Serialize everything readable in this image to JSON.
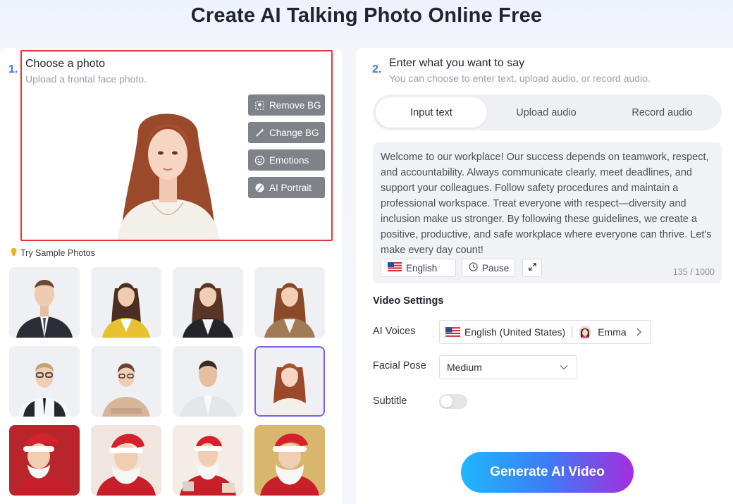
{
  "page": {
    "title": "Create AI Talking Photo Online Free"
  },
  "left": {
    "step_number": "1.",
    "title": "Choose a photo",
    "subtitle": "Upload a frontal face photo.",
    "tools": [
      {
        "label": "Remove BG",
        "icon": "remove-bg-icon"
      },
      {
        "label": "Change BG",
        "icon": "magic-wand-icon"
      },
      {
        "label": "Emotions",
        "icon": "smiley-icon"
      },
      {
        "label": "AI Portrait",
        "icon": "portrait-icon"
      }
    ],
    "samples_label": "Try Sample Photos",
    "samples_icon": "lightbulb-icon"
  },
  "right": {
    "step_number": "2.",
    "title": "Enter what you want to say",
    "subtitle": "You can choose to enter text, upload audio, or record audio.",
    "tabs": [
      "Input text",
      "Upload audio",
      "Record audio"
    ],
    "active_tab": "Input text",
    "text": "Welcome to our workplace! Our success depends on teamwork, respect, and accountability. Always communicate clearly, meet deadlines, and support your colleagues. Follow safety procedures and maintain a professional workspace. Treat everyone with respect—diversity and inclusion make us stronger. By following these guidelines, we create a positive, productive, and safe workplace where everyone can thrive. Let's make every day count!",
    "language_label": "English",
    "pause_label": "Pause",
    "char_count": "135 / 1000",
    "settings": {
      "title": "Video Settings",
      "voices_label": "AI Voices",
      "voice_language": "English (United States)",
      "voice_name": "Emma",
      "pose_label": "Facial Pose",
      "pose_value": "Medium",
      "subtitle_label": "Subtitle",
      "subtitle_on": false
    },
    "generate_label": "Generate AI Video"
  },
  "colors": {
    "accent": "#3c74f0",
    "highlight_border": "#e8333a",
    "tool_button": "#7f8389",
    "gradient_start": "#1fb7ff",
    "gradient_end": "#a52de0"
  }
}
